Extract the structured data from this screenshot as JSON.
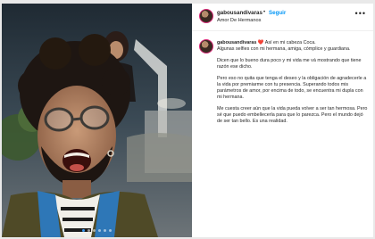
{
  "post": {
    "username": "gabousandivaras",
    "separator": "•",
    "follow_label": "Seguir",
    "location": "Amor De Hermanos",
    "more_label": "•••",
    "carousel": {
      "slides": 6,
      "active": 1
    },
    "caption": {
      "username": "gabousandivaras",
      "line1": "❤️ Así en mi cabeza Coca.",
      "line2": "Algunas selfies con mi hermana, amiga, cómplice y guardiana.",
      "para2": "Dicen que lo bueno dura poco y mi vida me vá mostrando que tiene razón ese dicho.",
      "para3": "Pero eso no quita que tenga el deseo y la obligación de agradecerle a la vida por premiarme con tu presencia. Superando todos mis parámetros de amor, por encima de todo, se encuentra mi dupla con mi hermana.",
      "para4": "Me cuesta creer aún que la vida pueda volver a ser tan hermosa. Pero sé que puedo embellecerla para que lo parezca. Pero el mundo dejó de ser tan bello. Es una realidad."
    }
  }
}
